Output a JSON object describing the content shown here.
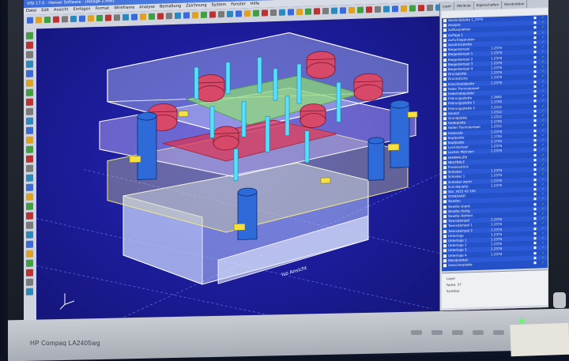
{
  "window": {
    "title": "VISI 17.0 - Hanser Software - [Ablage 2.mdl]"
  },
  "menu": {
    "items": [
      "Datei",
      "Edit",
      "Ansicht",
      "Einfügen",
      "Format",
      "Wireframe",
      "Analyse",
      "Bemaßung",
      "Zeichnung",
      "System",
      "Fenster",
      "Hilfe"
    ]
  },
  "panel": {
    "tabs": [
      "Layer",
      "Attribute",
      "Eigenschaften",
      "Konstruktion"
    ],
    "rows": [
      {
        "name": "Abstandplatte 1_2370",
        "value": "",
        "sel": false
      },
      {
        "name": "Analyse",
        "value": "",
        "sel": false
      },
      {
        "name": "Aufbauplatten",
        "value": "",
        "sel": false
      },
      {
        "name": "Auflage 1",
        "value": "",
        "sel": false
      },
      {
        "name": "Aufschlagplatten",
        "value": "",
        "sel": false
      },
      {
        "name": "Ausdrückplatte",
        "value": "",
        "sel": false
      },
      {
        "name": "Biegestempel",
        "value": "1.2379",
        "sel": false
      },
      {
        "name": "Biegestempel 1",
        "value": "1.2379",
        "sel": false
      },
      {
        "name": "Biegestempel 2",
        "value": "1.2379",
        "sel": false
      },
      {
        "name": "Biegestempel 3",
        "value": "1.2379",
        "sel": false
      },
      {
        "name": "Biegestempel 4",
        "value": "1.2379",
        "sel": false
      },
      {
        "name": "Druckplatte",
        "value": "1.2379",
        "sel": false
      },
      {
        "name": "Druckstücke",
        "value": "1.2379",
        "sel": false
      },
      {
        "name": "Einschneidplatte",
        "value": "1.2379",
        "sel": false
      },
      {
        "name": "Feder Trennstempel",
        "value": "",
        "sel": false
      },
      {
        "name": "Federhalteplatte",
        "value": "",
        "sel": false
      },
      {
        "name": "Führungsplatte",
        "value": "1.2842",
        "sel": false
      },
      {
        "name": "Führungsplatte 1",
        "value": "1.1730",
        "sel": false
      },
      {
        "name": "Führungsplatte 2",
        "value": "1.2312",
        "sel": false
      },
      {
        "name": "Gestell",
        "value": "1.2312",
        "sel": false
      },
      {
        "name": "Grundplatte",
        "value": "1.2312",
        "sel": false
      },
      {
        "name": "Halteplatte",
        "value": "1.1730",
        "sel": false
      },
      {
        "name": "Halter Trennstempel",
        "value": "1.2312",
        "sel": false
      },
      {
        "name": "Hubleiste",
        "value": "1.2379",
        "sel": false
      },
      {
        "name": "Kopfplatte",
        "value": "1.1730",
        "sel": false
      },
      {
        "name": "Kopfplatte",
        "value": "1.1730",
        "sel": false
      },
      {
        "name": "Lochstempel",
        "value": "1.2379",
        "sel": false
      },
      {
        "name": "Lochen Matrizen",
        "value": "1.2379",
        "sel": false
      },
      {
        "name": "NORMALIEN",
        "value": "",
        "sel": false
      },
      {
        "name": "NEUTRALE",
        "value": "",
        "sel": false
      },
      {
        "name": "Prozessstück",
        "value": "",
        "sel": false
      },
      {
        "name": "Schieber",
        "value": "1.2379",
        "sel": false
      },
      {
        "name": "Schieber 1",
        "value": "1.2379",
        "sel": false
      },
      {
        "name": "Schieber warm",
        "value": "1.2379",
        "sel": false
      },
      {
        "name": "Schnittplatte",
        "value": "1.2379",
        "sel": false
      },
      {
        "name": "Std. 3025 43 100",
        "value": "",
        "sel": false
      },
      {
        "name": "STANDARD",
        "value": "",
        "sel": false
      },
      {
        "name": "Streifen",
        "value": "",
        "sel": false
      },
      {
        "name": "Streifen blank",
        "value": "",
        "sel": false
      },
      {
        "name": "Streifen fertig",
        "value": "",
        "sel": false
      },
      {
        "name": "Streifen Rohteil",
        "value": "",
        "sel": false
      },
      {
        "name": "Trennstempel",
        "value": "1.2379",
        "sel": false
      },
      {
        "name": "Trennstempel 1",
        "value": "1.2379",
        "sel": false
      },
      {
        "name": "Trennstempel 2",
        "value": "1.2379",
        "sel": false
      },
      {
        "name": "Unterlage",
        "value": "1.2379",
        "sel": false
      },
      {
        "name": "Unterlage 1",
        "value": "1.2379",
        "sel": false
      },
      {
        "name": "Unterlage 2",
        "value": "1.2379",
        "sel": false
      },
      {
        "name": "Unterlage 3",
        "value": "1.2379",
        "sel": false
      },
      {
        "name": "Unterlage 4",
        "value": "1.2379",
        "sel": false
      },
      {
        "name": "Wandplatten",
        "value": "",
        "sel": false
      },
      {
        "name": "Zwischenplatte",
        "value": "",
        "sel": false
      }
    ],
    "check_mark": "✓",
    "props": [
      "Layer",
      "Farbe: 37",
      "Sichtbar"
    ]
  },
  "viewport": {
    "label": "Iso Ansicht"
  },
  "monitor": {
    "brand": "HP Compaq LA2405wg"
  },
  "colors": {
    "viewport_bg": "#1c1c9a",
    "tree_bg": "#2450c8",
    "tree_selected": "#ffffff"
  }
}
